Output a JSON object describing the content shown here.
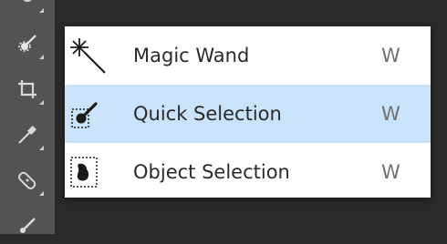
{
  "toolbar": {
    "tools": [
      {
        "icon": "quick-selection-icon"
      },
      {
        "icon": "crop-icon"
      },
      {
        "icon": "eyedropper-icon"
      },
      {
        "icon": "healing-brush-icon"
      },
      {
        "icon": "brush-icon"
      }
    ]
  },
  "menu": {
    "items": [
      {
        "label": "Magic Wand",
        "shortcut": "W",
        "icon": "magic-wand-icon",
        "selected": false
      },
      {
        "label": "Quick Selection",
        "shortcut": "W",
        "icon": "quick-selection-icon",
        "selected": true
      },
      {
        "label": "Object Selection",
        "shortcut": "W",
        "icon": "object-selection-icon",
        "selected": false
      }
    ],
    "highlight_color": "#c9e3fa"
  }
}
